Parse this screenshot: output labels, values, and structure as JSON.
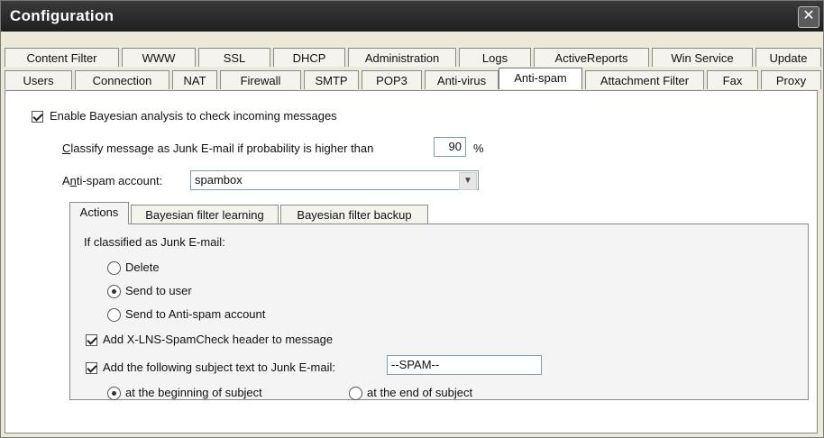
{
  "window": {
    "title": "Configuration",
    "close_label": "✕"
  },
  "tabs_row1": [
    "Content Filter",
    "WWW",
    "SSL",
    "DHCP",
    "Administration",
    "Logs",
    "ActiveReports",
    "Win Service",
    "Update"
  ],
  "tabs_row2": [
    "Users",
    "Connection",
    "NAT",
    "Firewall",
    "SMTP",
    "POP3",
    "Anti-virus",
    "Anti-spam",
    "Attachment Filter",
    "Fax",
    "Proxy"
  ],
  "active_tab": "Anti-spam",
  "bayesian": {
    "enable_label": "Enable Bayesian analysis to check incoming messages",
    "enable_checked": true,
    "classify_label_first": "C",
    "classify_label_rest": "lassify message as Junk E-mail if probability is higher than",
    "probability_value": "90",
    "percent_sign": "%",
    "account_label_first": "A",
    "account_label_u": "n",
    "account_label_rest": "ti-spam account:",
    "account_value": "spambox"
  },
  "inner_tabs": [
    "Actions",
    "Bayesian filter learning",
    "Bayesian filter backup"
  ],
  "actions": {
    "heading": "If classified as Junk E-mail:",
    "radio_options": [
      {
        "label": "Delete",
        "checked": false
      },
      {
        "label": "Send to user",
        "checked": true
      },
      {
        "label": "Send to Anti-spam account",
        "checked": false
      }
    ],
    "add_header_label": "Add X-LNS-SpamCheck header to message",
    "add_header_checked": true,
    "add_subject_label": "Add the following subject text to Junk E-mail:",
    "add_subject_checked": true,
    "subject_text": "--SPAM--",
    "position_options": [
      {
        "label": "at the beginning of subject",
        "checked": true
      },
      {
        "label": "at the end of subject",
        "checked": false
      }
    ]
  }
}
